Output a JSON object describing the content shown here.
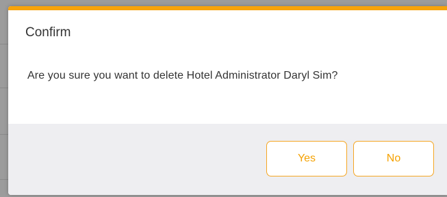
{
  "dialog": {
    "title": "Confirm",
    "message": "Are you sure you want to delete Hotel Administrator Daryl Sim?",
    "accent_color": "#f7a30b",
    "yes_label": "Yes",
    "no_label": "No"
  }
}
